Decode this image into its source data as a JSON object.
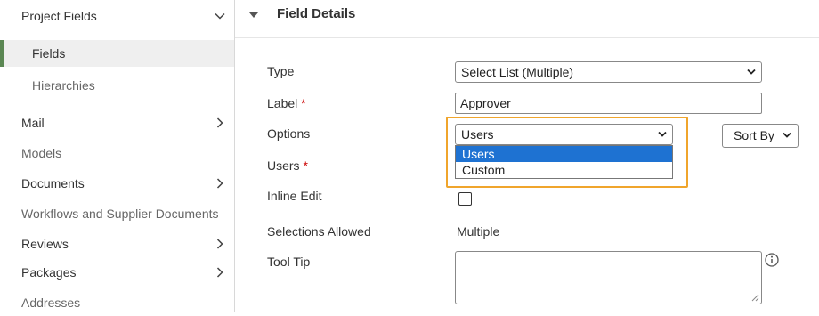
{
  "sidebar": {
    "items": [
      {
        "label": "Project Fields"
      },
      {
        "label": "Fields"
      },
      {
        "label": "Hierarchies"
      },
      {
        "label": "Mail"
      },
      {
        "label": "Models"
      },
      {
        "label": "Documents"
      },
      {
        "label": "Workflows and Supplier Documents"
      },
      {
        "label": "Reviews"
      },
      {
        "label": "Packages"
      },
      {
        "label": "Addresses"
      }
    ]
  },
  "section": {
    "title": "Field Details"
  },
  "form": {
    "type": {
      "label": "Type",
      "value": "Select List (Multiple)"
    },
    "label_field": {
      "label": "Label",
      "required": "*",
      "value": "Approver"
    },
    "options": {
      "label": "Options",
      "value": "Users",
      "dropdown": [
        "Users",
        "Custom"
      ],
      "selected_option": "Users"
    },
    "users": {
      "label": "Users",
      "required": "*"
    },
    "inline_edit": {
      "label": "Inline Edit",
      "checked": false
    },
    "selections_allowed": {
      "label": "Selections Allowed",
      "value": "Multiple"
    },
    "tool_tip": {
      "label": "Tool Tip",
      "value": ""
    }
  },
  "sort_by": {
    "label": "Sort By"
  },
  "colors": {
    "accent_green": "#5b8753",
    "highlight_orange": "#f0a52c",
    "selection_blue": "#1e72d2",
    "required_red": "#cc0000"
  },
  "icons": [
    "chevron-down-icon",
    "chevron-right-icon",
    "collapse-triangle-icon",
    "info-icon",
    "resize-grip-icon"
  ]
}
